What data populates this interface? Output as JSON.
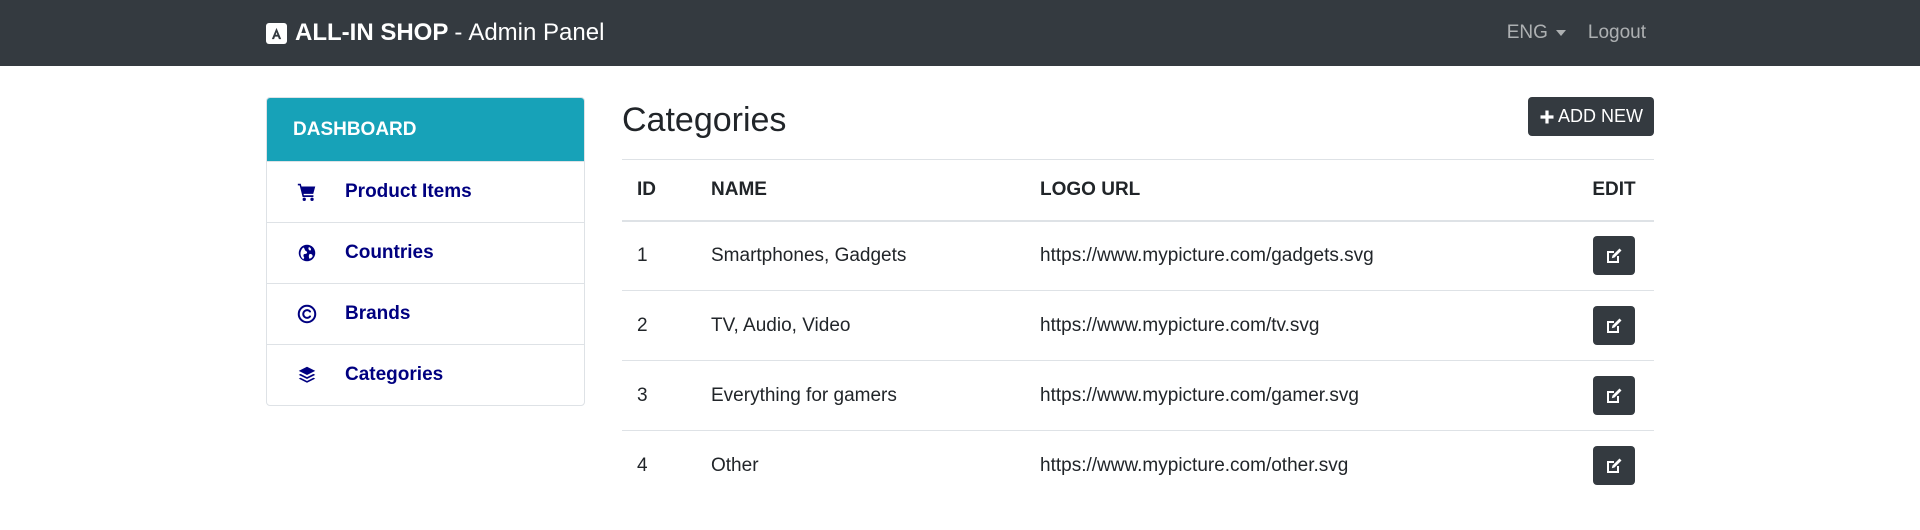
{
  "navbar": {
    "brand_name": "ALL-IN SHOP",
    "brand_separator": "-",
    "brand_subtitle": "Admin Panel",
    "language": "ENG",
    "logout": "Logout"
  },
  "sidebar": {
    "header": "DASHBOARD",
    "items": [
      {
        "label": "Product Items",
        "icon": "cart-icon"
      },
      {
        "label": "Countries",
        "icon": "globe-icon"
      },
      {
        "label": "Brands",
        "icon": "copyright-icon"
      },
      {
        "label": "Categories",
        "icon": "layers-icon"
      }
    ]
  },
  "main": {
    "title": "Categories",
    "add_button": "ADD NEW",
    "table": {
      "headers": {
        "id": "ID",
        "name": "NAME",
        "logo_url": "LOGO URL",
        "edit": "EDIT"
      },
      "rows": [
        {
          "id": "1",
          "name": "Smartphones, Gadgets",
          "logo_url": "https://www.mypicture.com/gadgets.svg"
        },
        {
          "id": "2",
          "name": "TV, Audio, Video",
          "logo_url": "https://www.mypicture.com/tv.svg"
        },
        {
          "id": "3",
          "name": "Everything for gamers",
          "logo_url": "https://www.mypicture.com/gamer.svg"
        },
        {
          "id": "4",
          "name": "Other",
          "logo_url": "https://www.mypicture.com/other.svg"
        }
      ]
    }
  },
  "colors": {
    "navbar_bg": "#343a40",
    "sidebar_header_bg": "#17a2b8",
    "sidebar_link": "#000080",
    "button_dark": "#343a40"
  }
}
